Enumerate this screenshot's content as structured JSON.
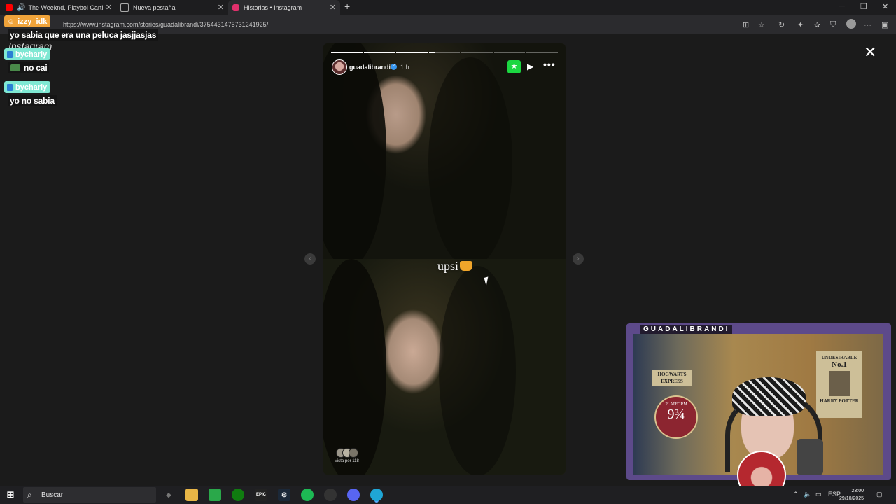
{
  "browser": {
    "tabs": [
      {
        "title": "The Weeknd, Playboi Carti -",
        "icon_color": "#ff0000",
        "active": false
      },
      {
        "title": "Nueva pestaña",
        "icon_color": "#9a9a9a",
        "active": false
      },
      {
        "title": "Historias • Instagram",
        "icon_color": "#e1306c",
        "active": true
      }
    ],
    "new_tab_glyph": "+",
    "url": "https://www.instagram.com/stories/guadalibrandi/3754431475731241925/"
  },
  "chat": {
    "messages": [
      {
        "user": "izzy_idk",
        "user_color": "#f0a33a",
        "text": "yo sabia que era una peluca jasjjasjas"
      },
      {
        "user": "bycharly",
        "user_color": "#7fe8d3",
        "text": "no cai"
      },
      {
        "user": "bycharly",
        "user_color": "#7fe8d3",
        "text": "yo no sabia"
      }
    ],
    "ghost_text": "Instagram"
  },
  "story": {
    "username": "guadalibrandi",
    "time": "1 h",
    "caption": "upsi",
    "viewers_label": "Vista por 118",
    "progress_segments": [
      "done",
      "done",
      "done",
      "current",
      "empty",
      "empty",
      "empty"
    ],
    "close_friends_icon": "star-icon"
  },
  "webcam": {
    "title": "GUADALIBRANDI",
    "posters": {
      "hogwarts": "HOGWARTS EXPRESS",
      "platform_top": "PLATFORM",
      "platform_num": "9¾",
      "undesirable": "UNDESIRABLE",
      "no1": "No.1",
      "harry": "HARRY POTTER"
    }
  },
  "taskbar": {
    "search_label": "Buscar",
    "lang": "ESP",
    "time": "23:00",
    "date": "29/10/2025"
  },
  "colors": {
    "close_friends": "#1bd741",
    "verified": "#3797f0",
    "cam_border": "#5d4a8a"
  }
}
